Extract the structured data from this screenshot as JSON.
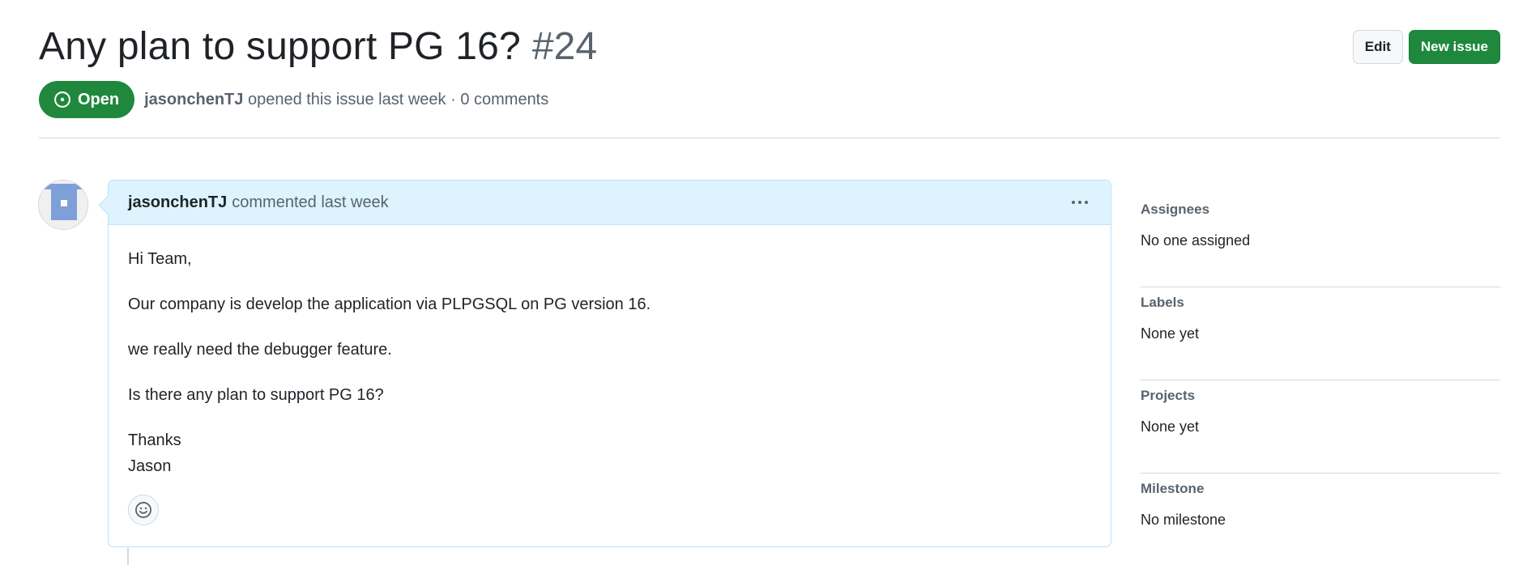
{
  "issue": {
    "title": "Any plan to support PG 16?",
    "number": "#24",
    "state": "Open",
    "author": "jasonchenTJ",
    "meta_suffix": "opened this issue last week · 0 comments"
  },
  "header_actions": {
    "edit_label": "Edit",
    "new_issue_label": "New issue"
  },
  "comment": {
    "author": "jasonchenTJ",
    "action": "commented last week",
    "body": [
      "Hi Team,",
      "Our company is develop the application via PLPGSQL on PG version 16.",
      "we really need the debugger feature.",
      "Is there any plan to support PG 16?"
    ],
    "signoff_line1": "Thanks",
    "signoff_line2": "Jason"
  },
  "sidebar": {
    "sections": [
      {
        "heading": "Assignees",
        "value": "No one assigned"
      },
      {
        "heading": "Labels",
        "value": "None yet"
      },
      {
        "heading": "Projects",
        "value": "None yet"
      },
      {
        "heading": "Milestone",
        "value": "No milestone"
      }
    ]
  },
  "icons": {
    "state": "issue-opened-icon",
    "menu": "kebab-horizontal-icon",
    "reaction": "smiley-icon"
  },
  "colors": {
    "open_green": "#1f883d",
    "comment_header_bg": "#ddf4ff",
    "comment_border": "#b6e3ff",
    "muted_text": "#59636e"
  }
}
